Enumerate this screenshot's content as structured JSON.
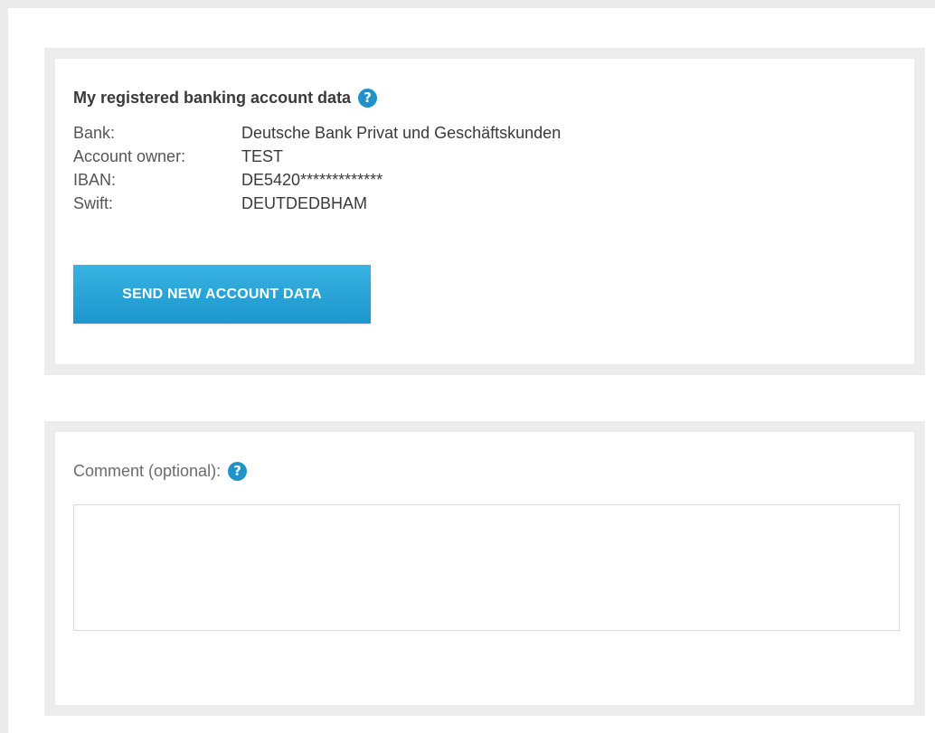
{
  "banking_section": {
    "heading": "My registered banking account data",
    "help_icon": "question-circle-icon",
    "rows": [
      {
        "label": "Bank:",
        "value": "Deutsche Bank Privat und Geschäftskunden"
      },
      {
        "label": "Account owner:",
        "value": "TEST"
      },
      {
        "label": "IBAN:",
        "value": "DE5420*************"
      },
      {
        "label": "Swift:",
        "value": "DEUTDEDBHAM"
      }
    ],
    "send_button_label": "SEND NEW ACCOUNT DATA"
  },
  "comment_section": {
    "label": "Comment (optional):",
    "help_icon": "question-circle-icon",
    "value": ""
  },
  "colors": {
    "accent": "#1f93c8",
    "button_top": "#39b3e2",
    "button_bottom": "#1c96cd",
    "panel_border": "#ececec"
  }
}
